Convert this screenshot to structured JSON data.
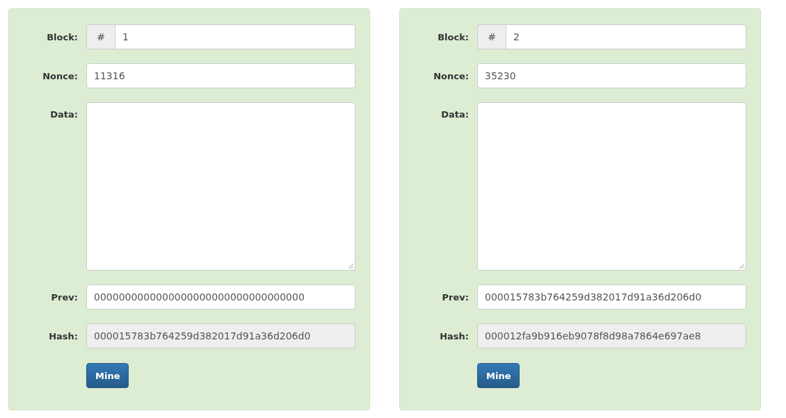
{
  "blocks": [
    {
      "fields": [
        {
          "kind": "prefixed",
          "label": "Block:",
          "prefix": "#",
          "value": "1"
        },
        {
          "kind": "text",
          "label": "Nonce:",
          "value": "11316",
          "disabled": false
        },
        {
          "kind": "textarea",
          "label": "Data:"
        },
        {
          "kind": "text",
          "label": "Prev:",
          "value": "0000000000000000000000000000000000",
          "disabled": false
        },
        {
          "kind": "text",
          "label": "Hash:",
          "value": "000015783b764259d382017d91a36d206d0",
          "disabled": true
        }
      ],
      "button": "Mine"
    },
    {
      "fields": [
        {
          "kind": "prefixed",
          "label": "Block:",
          "prefix": "#",
          "value": "2"
        },
        {
          "kind": "text",
          "label": "Nonce:",
          "value": "35230",
          "disabled": false
        },
        {
          "kind": "textarea",
          "label": "Data:"
        },
        {
          "kind": "text",
          "label": "Prev:",
          "value": "000015783b764259d382017d91a36d206d0",
          "disabled": false
        },
        {
          "kind": "text",
          "label": "Hash:",
          "value": "000012fa9b916eb9078f8d98a7864e697ae8",
          "disabled": true
        }
      ],
      "button": "Mine"
    }
  ]
}
